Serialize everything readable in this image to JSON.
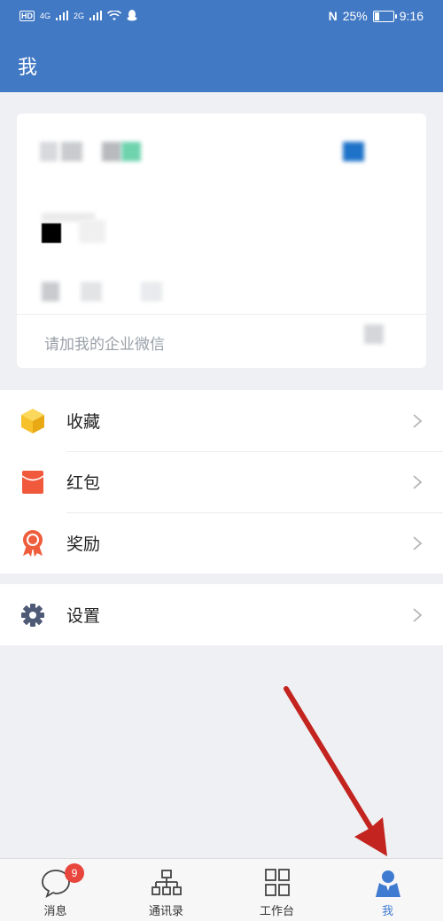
{
  "status_bar": {
    "hd": "HD",
    "net1": "4G",
    "net2": "2G",
    "battery_percent": "25%",
    "battery_level": 0.25,
    "time": "9:16"
  },
  "header": {
    "title": "我"
  },
  "profile_card": {
    "footer_text": "请加我的企业微信"
  },
  "menu": {
    "favorites": "收藏",
    "red_packet": "红包",
    "rewards": "奖励",
    "settings": "设置"
  },
  "tabbar": {
    "messages": {
      "label": "消息",
      "badge": "9"
    },
    "contacts": {
      "label": "通讯录"
    },
    "workbench": {
      "label": "工作台"
    },
    "me": {
      "label": "我"
    }
  },
  "colors": {
    "header_bg": "#4279c4",
    "accent_blue": "#3f7bd0",
    "badge_red": "#e8453c",
    "favorites_yellow": "#f6c12b",
    "red_packet": "#f0593b",
    "rewards_orange": "#ee5d3c",
    "settings_gray": "#4e5a76",
    "annotation_arrow": "#c3241f"
  }
}
